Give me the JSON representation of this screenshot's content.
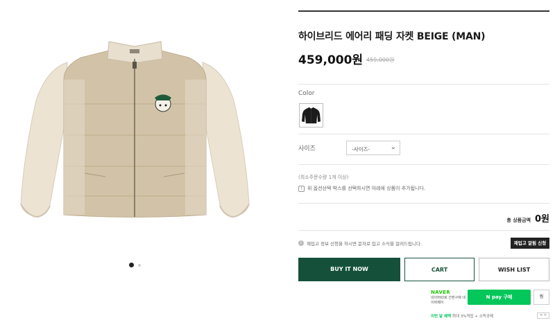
{
  "product": {
    "title": "하이브리드 에어리 패딩 자켓 BEIGE (MAN)",
    "price": "459,000원",
    "original_price": "459,000원",
    "image_alt": "beige hybrid airy padded jacket"
  },
  "gallery": {
    "dots": 2,
    "active_index": 0
  },
  "options": {
    "color_label": "Color",
    "size_label": "사이즈",
    "size_selected": "-사이즈-"
  },
  "notes": {
    "min_qty": "(최소주문수량 1개 이상)",
    "notice": "위 옵션선택 박스를 선택하시면 아래에 상품이 추가됩니다.",
    "notice_icon": "!"
  },
  "total": {
    "label": "총 상품금액",
    "amount": "0원"
  },
  "restock": {
    "note": "재입고 정보 신청을 하시면 문자로 입고 소식을 알려드립니다.",
    "button": "재입고 알림 신청"
  },
  "actions": {
    "buy_now": "BUY IT NOW",
    "cart": "CART",
    "wishlist": "WISH LIST"
  },
  "npay": {
    "brand": "NAVER",
    "sub": "네이버ID로 간편구매 네이버페이",
    "pay_button": "pay 구매",
    "pay_icon": "N",
    "wish_button": "찜",
    "benefit_label": "이번 달 혜택",
    "benefit_text": "최대 3%적립 + 소득공제",
    "pager": "< >"
  },
  "colors": {
    "accent": "#15513a",
    "naver_green": "#03c75a"
  }
}
